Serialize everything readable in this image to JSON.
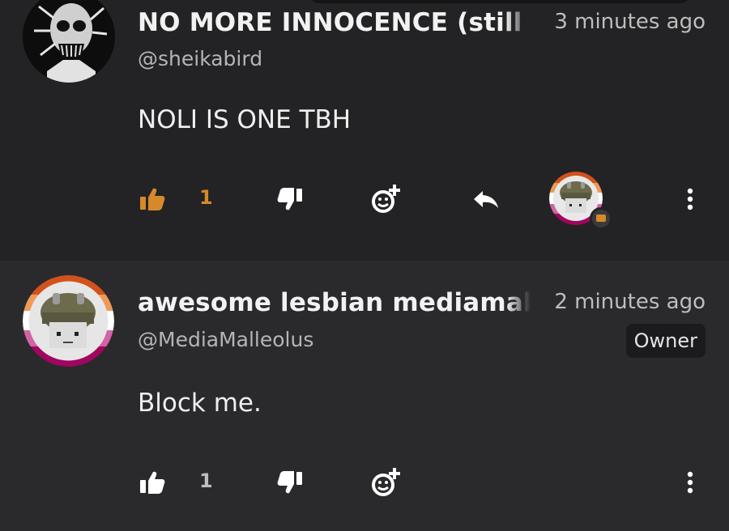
{
  "comments": [
    {
      "author_name": "NO MORE INNOCENCE (still",
      "handle": "@sheikabird",
      "timestamp": "3 minutes ago",
      "text": "NOLI IS ONE TBH",
      "likes": "1",
      "liked": true,
      "liked_color": "#d48a2a",
      "has_reply_avatar": true
    },
    {
      "author_name": "awesome lesbian mediamalle",
      "handle": "@MediaMalleolus",
      "timestamp": "2 minutes ago",
      "badge": "Owner",
      "text": "Block me.",
      "likes": "1",
      "liked": false
    }
  ],
  "icons": [
    "thumbs-up-icon",
    "thumbs-down-icon",
    "add-emoji-icon",
    "reply-icon",
    "more-options-icon"
  ]
}
